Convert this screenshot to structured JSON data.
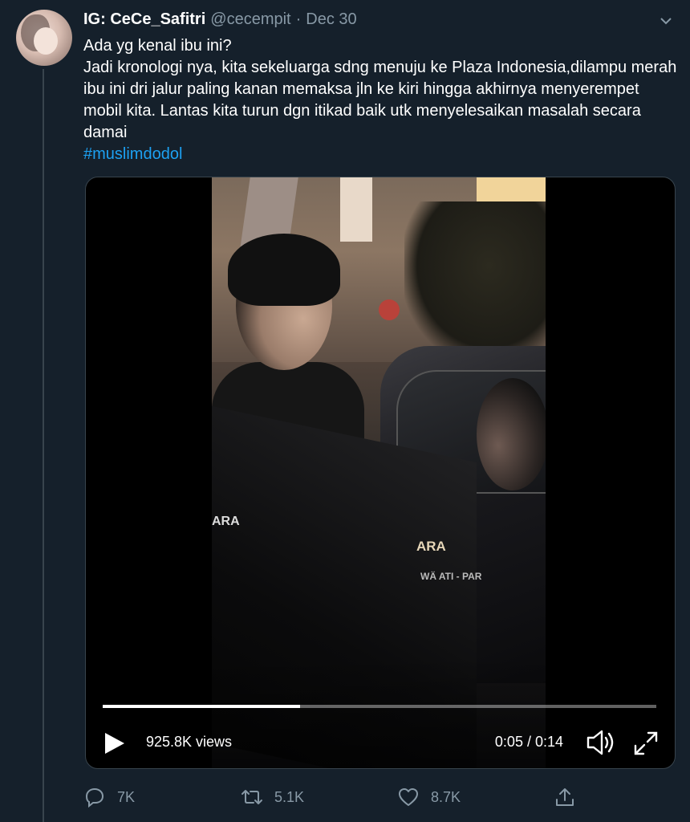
{
  "tweet": {
    "display_name": "IG: CeCe_Safitri",
    "handle": "@cecempit",
    "separator": "·",
    "date": "Dec 30",
    "text_lines": [
      "Ada yg kenal ibu ini?",
      "Jadi kronologi nya, kita sekeluarga sdng menuju ke Plaza Indonesia,dilampu merah ibu ini dri jalur paling kanan memaksa jln ke kiri hingga akhirnya menyerempet mobil kita. Lantas kita turun dgn itikad baik utk menyelesaikan masalah secara damai"
    ],
    "hashtag": "#muslimdodol"
  },
  "video": {
    "views": "925.8K views",
    "time": "0:05 / 0:14",
    "progress": 0.357,
    "frame_texts": [
      "ARA",
      "ARА",
      "WÄ ATI - PAR"
    ]
  },
  "actions": {
    "reply_count": "7K",
    "retweet_count": "5.1K",
    "like_count": "8.7K"
  },
  "icons": {
    "caret": "chevron-down-icon",
    "reply": "reply-icon",
    "retweet": "retweet-icon",
    "like": "heart-icon",
    "share": "share-icon",
    "play": "play-icon",
    "volume": "volume-icon",
    "fullscreen": "fullscreen-icon"
  },
  "colors": {
    "background": "#15202b",
    "accent": "#1da1f2",
    "muted": "#8899a6",
    "border": "#38444d"
  }
}
